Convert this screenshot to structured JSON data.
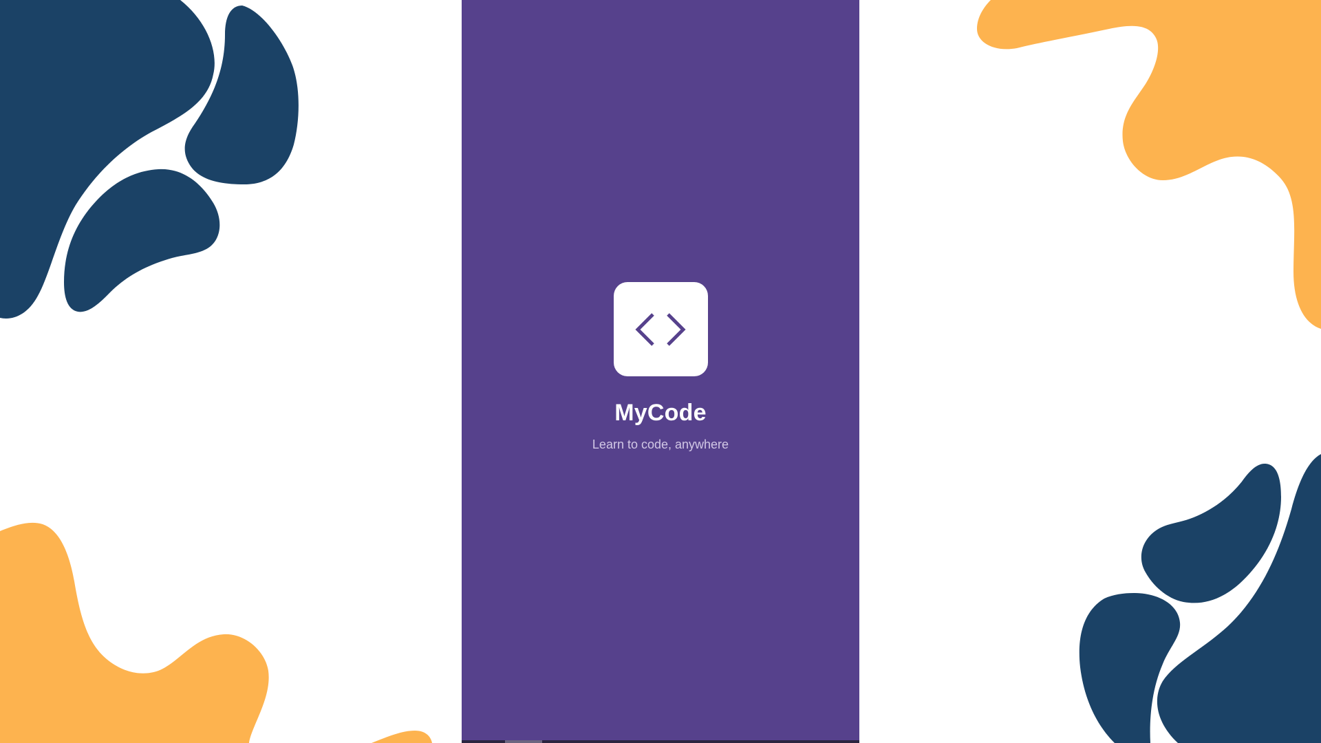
{
  "app": {
    "name": "MyCode",
    "tagline": "Learn to code, anywhere",
    "icon": "code-brackets-icon"
  },
  "colors": {
    "splash_background": "#56418c",
    "icon_tile": "#ffffff",
    "icon_glyph": "#56418c",
    "tagline": "#d2c8e6",
    "blob_navy": "#1b4266",
    "blob_orange": "#fdb34f",
    "page_background": "#ffffff"
  },
  "decorations": {
    "top_left": "navy-blob-cluster",
    "top_right": "orange-blob",
    "bottom_left": "orange-blob",
    "bottom_right": "navy-blob-cluster"
  }
}
